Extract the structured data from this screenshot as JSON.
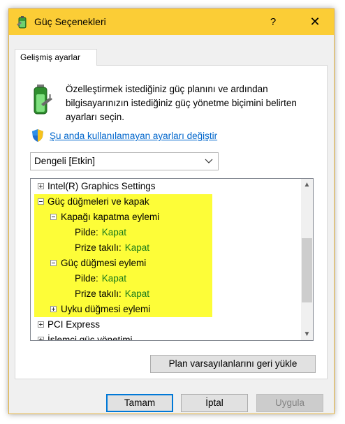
{
  "window": {
    "title": "Güç Seçenekleri",
    "help_label": "?",
    "close_label": "✕"
  },
  "tab": {
    "label": "Gelişmiş ayarlar"
  },
  "description": "Özelleştirmek istediğiniz güç planını ve ardından bilgisayarınızın istediğiniz güç yönetme biçimini belirten ayarları seçin.",
  "change_link": "Şu anda kullanılamayan ayarları değiştir",
  "plan_select": {
    "value": "Dengeli [Etkin]"
  },
  "tree": {
    "items": [
      {
        "label": "Intel(R) Graphics Settings",
        "expander": "plus"
      },
      {
        "label": "Güç düğmeleri ve kapak",
        "expander": "minus"
      },
      {
        "label": "Kapağı kapatma eylemi",
        "expander": "minus"
      },
      {
        "label": "Pilde:",
        "value": "Kapat"
      },
      {
        "label": "Prize takılı:",
        "value": "Kapat"
      },
      {
        "label": "Güç düğmesi eylemi",
        "expander": "minus"
      },
      {
        "label": "Pilde:",
        "value": "Kapat"
      },
      {
        "label": "Prize takılı:",
        "value": "Kapat"
      },
      {
        "label": "Uyku düğmesi eylemi",
        "expander": "plus"
      },
      {
        "label": "PCI Express",
        "expander": "plus"
      },
      {
        "label": "İşlemci güç yönetimi",
        "expander": "plus"
      }
    ]
  },
  "buttons": {
    "restore": "Plan varsayılanlarını geri yükle",
    "ok": "Tamam",
    "cancel": "İptal",
    "apply": "Uygula"
  },
  "colors": {
    "titlebar": "#fbcd36",
    "highlight": "#fdfd38",
    "value_text": "#1b7a1b",
    "link": "#0066cc"
  }
}
